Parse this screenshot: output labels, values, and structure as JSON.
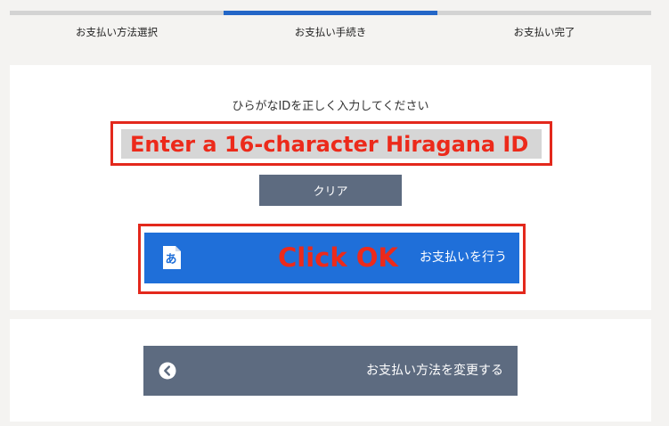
{
  "steps": [
    {
      "label": "お支払い方法選択",
      "state": "inactive"
    },
    {
      "label": "お支払い手続き",
      "state": "active"
    },
    {
      "label": "お支払い完了",
      "state": "inactive"
    }
  ],
  "form": {
    "instruction": "ひらがなIDを正しく入力してください",
    "id_input_value": "",
    "id_input_placeholder": "Enter a 16-character Hiragana ID",
    "clear_label": "クリア",
    "pay_annotation": "Click OK",
    "pay_label": "お支払いを行う",
    "pay_icon_glyph": "あ"
  },
  "footer": {
    "change_method_label": "お支払い方法を変更する"
  },
  "colors": {
    "accent_blue": "#1f6fd9",
    "step_active": "#2366c7",
    "annotation_red": "#e3281c",
    "button_slate": "#5d6b80"
  },
  "icons": {
    "pay_button_icon": "hiragana-keyboard-icon",
    "back_button_icon": "chevron-left-circle-icon"
  }
}
